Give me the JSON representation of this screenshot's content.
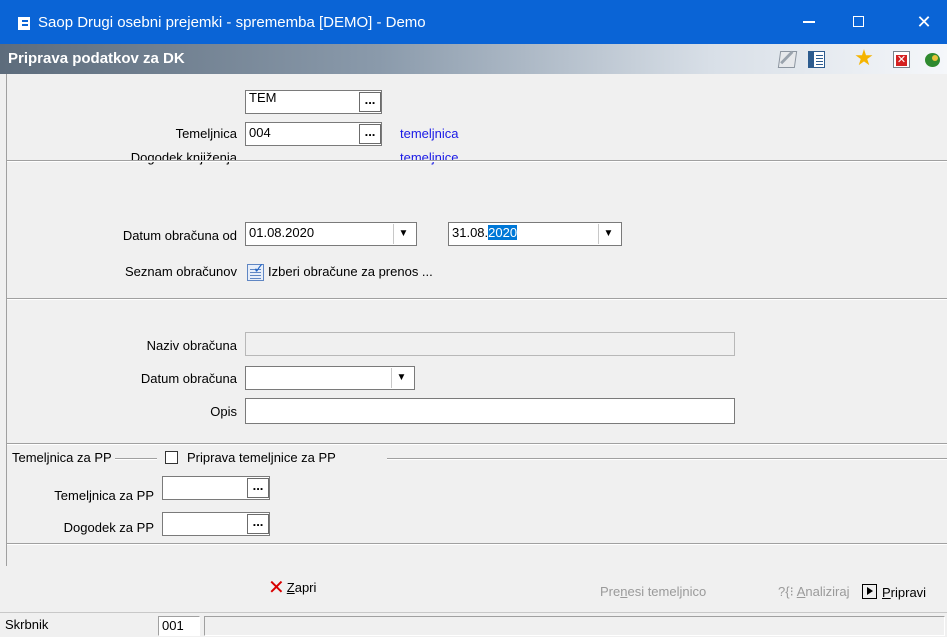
{
  "window": {
    "title": "Saop  Drugi osebni prejemki - sprememba [DEMO] - Demo",
    "min_glyph": "—",
    "close_glyph": "✕"
  },
  "header": {
    "title": "Priprava podatkov za DK",
    "toolbar_icons": [
      "edit-icon",
      "table-settings-icon",
      "favorite-star-icon",
      "delete-icon",
      "exit-icon"
    ],
    "star_glyph": "★"
  },
  "form": {
    "temeljnica": {
      "label": "Temeljnica",
      "value": "TEM",
      "desc": "temeljnica"
    },
    "dogodek": {
      "label": "Dogodek knjiženja",
      "value": "004",
      "desc": "temeljnice"
    },
    "datum_od": {
      "label": "Datum obračuna od",
      "value": "01.08.2020"
    },
    "datum_do": {
      "value_prefix": "31.08.",
      "value_selected": "2020"
    },
    "seznam": {
      "label": "Seznam obračunov",
      "link": "Izberi obračune za prenos ..."
    },
    "naziv": {
      "label": "Naziv obračuna",
      "value": ""
    },
    "datum_obracuna": {
      "label": "Datum obračuna",
      "value": ""
    },
    "opis": {
      "label": "Opis",
      "value": ""
    },
    "dots_glyph": "...",
    "dropdown_glyph": "▼"
  },
  "pp_group": {
    "group_label": "Temeljnica za PP",
    "checkbox_label": "Priprava temeljnice za PP",
    "checkbox_checked": false,
    "temeljnica_pp": {
      "label": "Temeljnica za PP",
      "value": ""
    },
    "dogodek_pp": {
      "label": "Dogodek za PP",
      "value": ""
    }
  },
  "buttons": {
    "zapri": {
      "pre": "",
      "accel": "Z",
      "rest": "apri"
    },
    "prenesi": {
      "pre": "Pre",
      "accel": "n",
      "rest": "esi temeljnico"
    },
    "analiziraj": {
      "glyph": "?{⁝",
      "pre": "",
      "accel": "A",
      "rest": "naliziraj"
    },
    "pripravi": {
      "pre": "",
      "accel": "P",
      "rest": "ripravi"
    },
    "close_glyph": "✕"
  },
  "status": {
    "label": "Skrbnik",
    "value": "001",
    "extra": ""
  }
}
